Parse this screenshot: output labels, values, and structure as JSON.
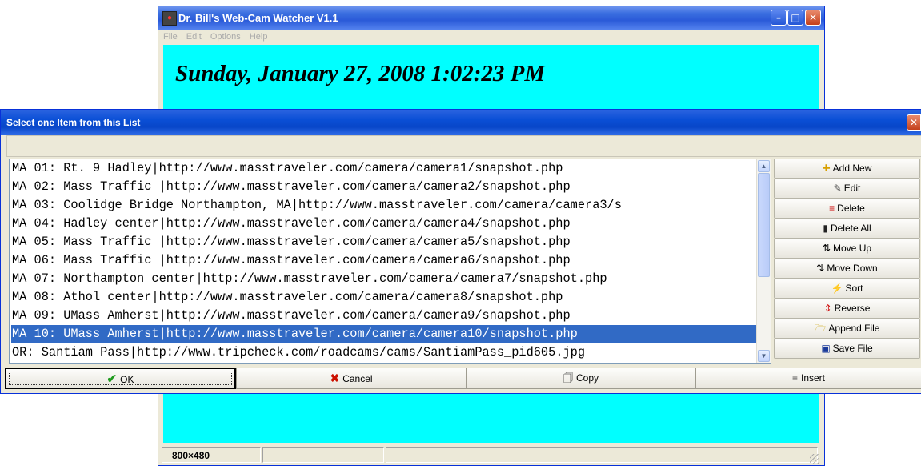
{
  "main_window": {
    "title": "Dr. Bill's Web-Cam Watcher V1.1",
    "menu": [
      "File",
      "Edit",
      "Options",
      "Help"
    ],
    "clock": "Sunday, January 27, 2008 1:02:23 PM",
    "status": {
      "resolution": "800×480"
    },
    "background_color": "#00ffff"
  },
  "dialog": {
    "title": "Select one Item from this List",
    "list_items": [
      "MA 01: Rt. 9 Hadley|http://www.masstraveler.com/camera/camera1/snapshot.php",
      "MA 02: Mass Traffic |http://www.masstraveler.com/camera/camera2/snapshot.php",
      "MA 03: Coolidge Bridge Northampton, MA|http://www.masstraveler.com/camera/camera3/s",
      "MA 04: Hadley center|http://www.masstraveler.com/camera/camera4/snapshot.php",
      "MA 05: Mass Traffic |http://www.masstraveler.com/camera/camera5/snapshot.php",
      "MA 06: Mass Traffic |http://www.masstraveler.com/camera/camera6/snapshot.php",
      "MA 07: Northampton center|http://www.masstraveler.com/camera/camera7/snapshot.php",
      "MA 08: Athol center|http://www.masstraveler.com/camera/camera8/snapshot.php",
      "MA 09: UMass Amherst|http://www.masstraveler.com/camera/camera9/snapshot.php",
      "MA 10: UMass Amherst|http://www.masstraveler.com/camera/camera10/snapshot.php",
      "OR: Santiam Pass|http://www.tripcheck.com/roadcams/cams/SantiamPass_pid605.jpg"
    ],
    "selected_item": "MA 10: UMass Amherst|http://www.masstraveler.com/camera/camera10/snapshot.php",
    "side_buttons": {
      "add_new": "Add New",
      "edit": "Edit",
      "delete": "Delete",
      "delete_all": "Delete All",
      "move_up": "Move Up",
      "move_down": "Move Down",
      "sort": "Sort",
      "reverse": "Reverse",
      "append_file": "Append File",
      "save_file": "Save File"
    },
    "bottom_buttons": {
      "ok": "OK",
      "cancel": "Cancel",
      "copy": "Copy",
      "insert": "Insert"
    },
    "selection_color": "#316ac5"
  }
}
